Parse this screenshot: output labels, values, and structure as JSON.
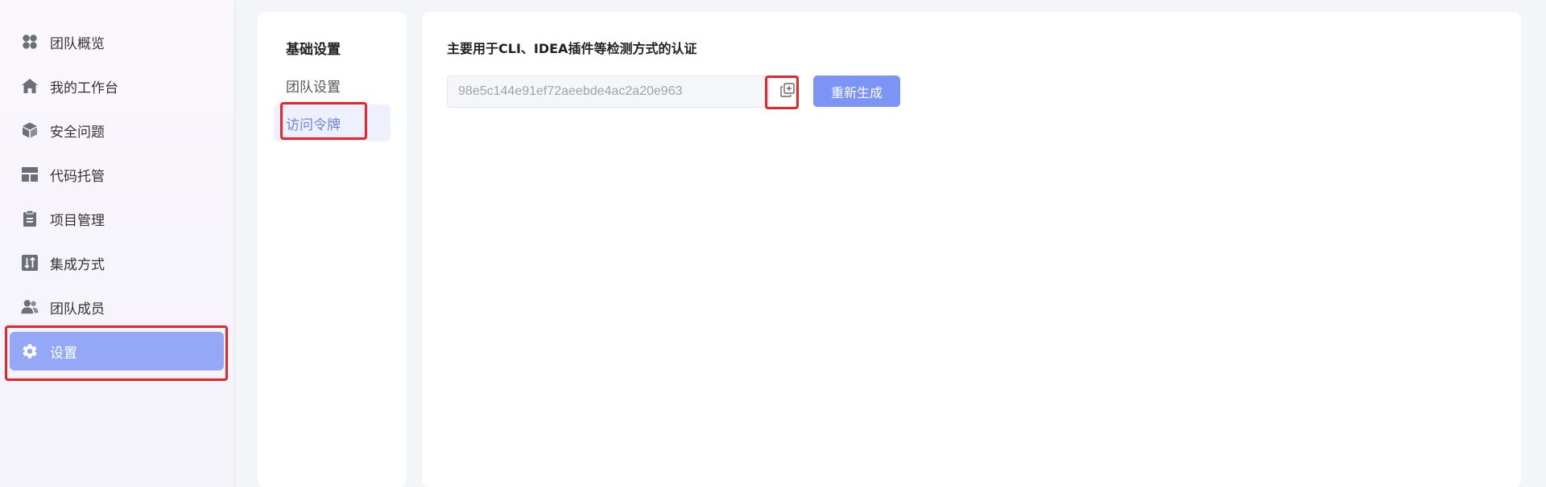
{
  "sidebar": {
    "items": [
      {
        "label": "团队概览",
        "icon": "grid-flower-icon"
      },
      {
        "label": "我的工作台",
        "icon": "home-icon"
      },
      {
        "label": "安全问题",
        "icon": "cube-icon"
      },
      {
        "label": "代码托管",
        "icon": "layout-icon"
      },
      {
        "label": "项目管理",
        "icon": "clipboard-icon"
      },
      {
        "label": "集成方式",
        "icon": "sort-arrows-icon"
      },
      {
        "label": "团队成员",
        "icon": "users-icon"
      },
      {
        "label": "设置",
        "icon": "gear-icon",
        "active": true
      }
    ]
  },
  "submenu": {
    "group_title": "基础设置",
    "items": [
      {
        "label": "团队设置"
      },
      {
        "label": "访问令牌",
        "active": true
      }
    ]
  },
  "main": {
    "description": "主要用于CLI、IDEA插件等检测方式的认证",
    "token_value": "98e5c144e91ef72aeebde4ac2a20e963",
    "copy_icon": "copy-icon",
    "regenerate_label": "重新生成"
  },
  "colors": {
    "active_nav_bg": "#94a8f7",
    "primary_button": "#7b94f5",
    "active_sub_text": "#6b84e8",
    "highlight": "#e8252b"
  }
}
